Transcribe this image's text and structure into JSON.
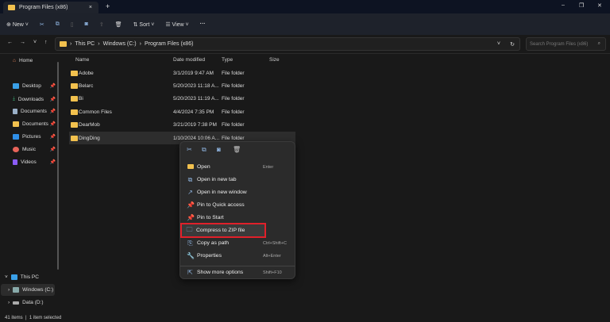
{
  "window": {
    "tab_title": "Program Files (x86)",
    "close_tab": "×",
    "new_tab": "+",
    "minimize": "–",
    "maximize": "❐",
    "close": "✕"
  },
  "toolbar": {
    "new_label": "New",
    "sort_label": "Sort",
    "view_label": "View",
    "more": "···"
  },
  "address": {
    "breadcrumb": [
      "This PC",
      "Windows (C:)",
      "Program Files (x86)"
    ],
    "search_placeholder": "Search Program Files (x86)"
  },
  "sidebar": {
    "home": "Home",
    "quick": [
      {
        "label": "Desktop",
        "color": "#3aa0e8"
      },
      {
        "label": "Downloads",
        "color": "#3fbf7f"
      },
      {
        "label": "Documents",
        "color": "#9ab0c8"
      },
      {
        "label": "Documents",
        "color": "#f2c14e"
      },
      {
        "label": "Pictures",
        "color": "#2f8fe8"
      },
      {
        "label": "Music",
        "color": "#e8645a"
      },
      {
        "label": "Videos",
        "color": "#8b5cf6"
      }
    ],
    "this_pc": "This PC",
    "drives": [
      "Windows (C:)",
      "Data (D:)"
    ]
  },
  "columns": {
    "name": "Name",
    "date": "Date modified",
    "type": "Type",
    "size": "Size"
  },
  "files": [
    {
      "name": "Adobe",
      "date": "3/1/2019 9:47 AM",
      "type": "File folder"
    },
    {
      "name": "Belarc",
      "date": "5/20/2023 11:18 A...",
      "type": "File folder"
    },
    {
      "name": "Bi",
      "date": "5/20/2023 11:19 A...",
      "type": "File folder"
    },
    {
      "name": "Common Files",
      "date": "4/4/2024 7:35 PM",
      "type": "File folder"
    },
    {
      "name": "DearMob",
      "date": "3/21/2019 7:38 PM",
      "type": "File folder"
    },
    {
      "name": "DingDing",
      "date": "1/10/2024 10:06 A...",
      "type": "File folder"
    }
  ],
  "context_menu": {
    "items": [
      {
        "label": "Open",
        "shortcut": "Enter",
        "icon": "📂"
      },
      {
        "label": "Open in new tab",
        "shortcut": "",
        "icon": "⧉"
      },
      {
        "label": "Open in new window",
        "shortcut": "",
        "icon": "↗"
      },
      {
        "label": "Pin to Quick access",
        "shortcut": "",
        "icon": "📌"
      },
      {
        "label": "Pin to Start",
        "shortcut": "",
        "icon": "📌"
      },
      {
        "label": "Compress to ZIP file",
        "shortcut": "",
        "icon": "🗀"
      },
      {
        "label": "Copy as path",
        "shortcut": "Ctrl+Shift+C",
        "icon": "⎘"
      },
      {
        "label": "Properties",
        "shortcut": "Alt+Enter",
        "icon": "🔧"
      }
    ],
    "more": {
      "label": "Show more options",
      "shortcut": "Shift+F10"
    },
    "highlight_color": "#e0202a"
  },
  "status": {
    "items": "41 items",
    "selected": "1 item selected"
  }
}
